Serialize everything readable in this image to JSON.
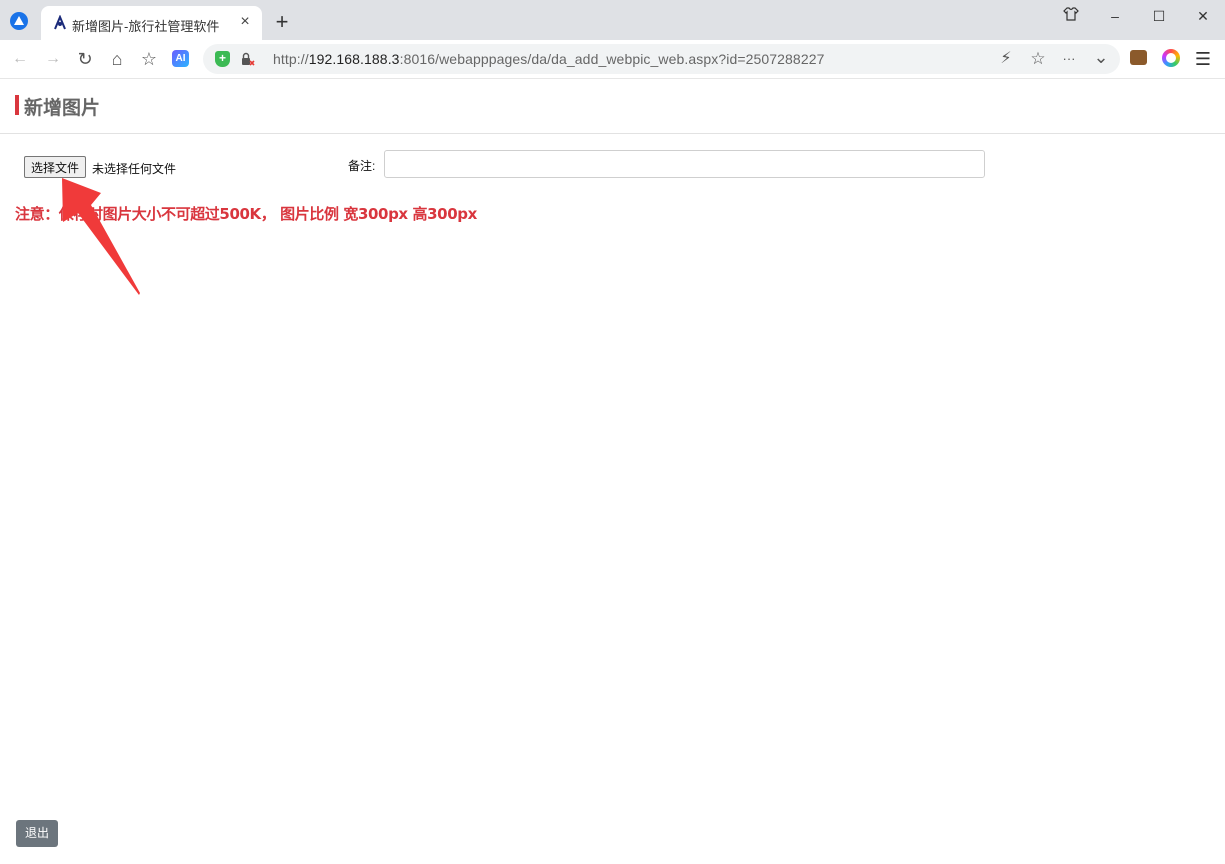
{
  "browser": {
    "tab": {
      "title": "新增图片-旅行社管理软件",
      "close": "×"
    },
    "new_tab": "+",
    "window_controls": {
      "skin": "⌂",
      "minimize": "–",
      "maximize": "☐",
      "close": "✕"
    },
    "nav": {
      "back": "←",
      "forward": "→",
      "reload": "↻",
      "home": "⌂",
      "favorites": "☆"
    },
    "address": {
      "scheme": "http://",
      "host": "192.168.188.3",
      "rest": ":8016/webapppages/da/da_add_webpic_web.aspx?id=2507288227"
    },
    "address_actions": {
      "flash": "⚡",
      "star": "☆",
      "more": "···",
      "dropdown": "⌄"
    },
    "ai_label": "AI",
    "menu": "☰"
  },
  "page": {
    "title": "新增图片",
    "file_button": "选择文件",
    "file_status": "未选择任何文件",
    "remark_label": "备注:",
    "remark_value": "",
    "notice": "注意：保存时图片大小不可超过500K， 图片比例 宽300px 高300px",
    "exit_button": "退出"
  },
  "colors": {
    "accent_red": "#d9363e",
    "exit_button": "#6c757d",
    "tabbar": "#dfe1e5"
  }
}
